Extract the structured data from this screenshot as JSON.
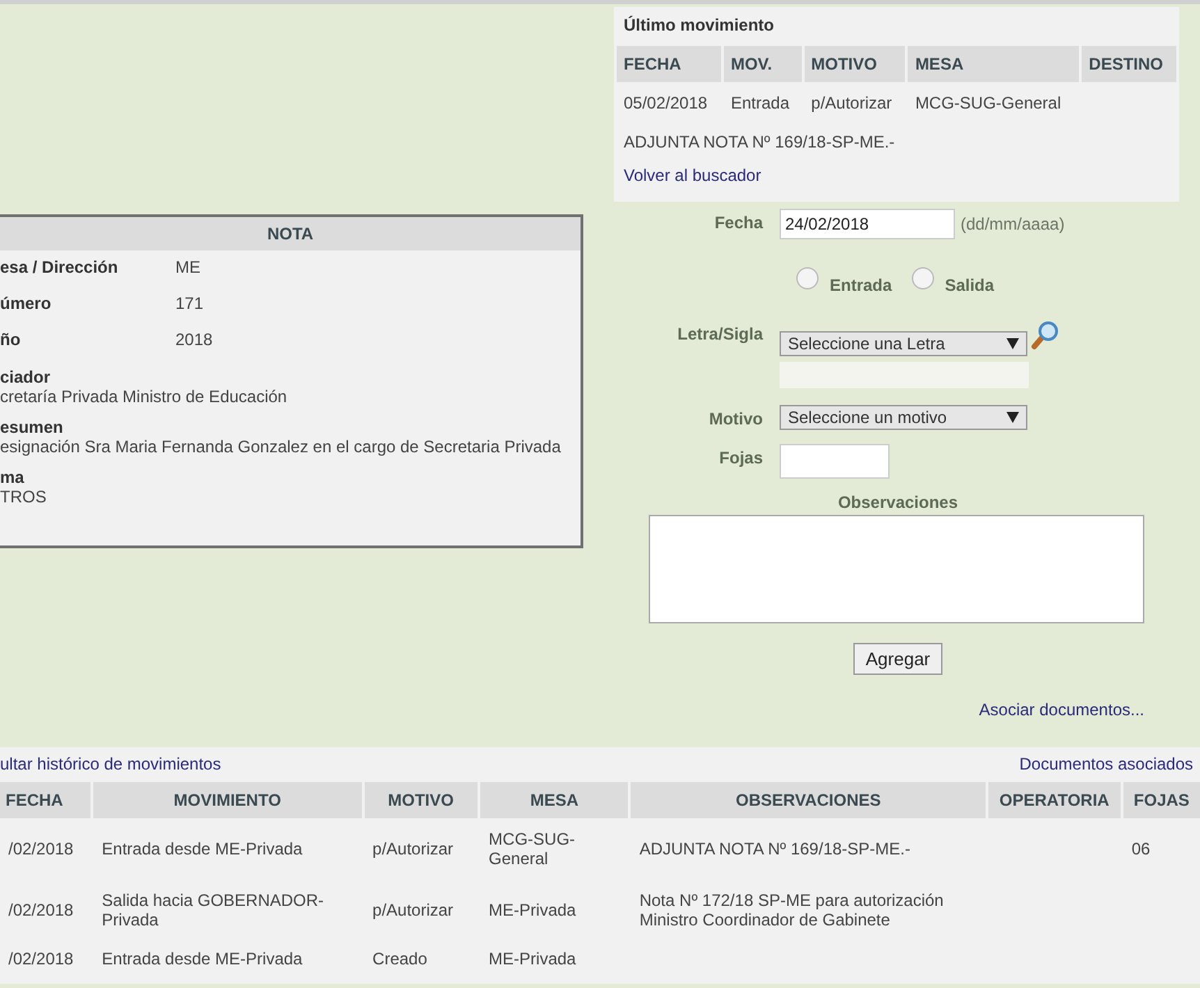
{
  "last_movement": {
    "title": "Último movimiento",
    "columns": [
      "FECHA",
      "MOV.",
      "MOTIVO",
      "MESA",
      "DESTINO"
    ],
    "row": [
      "05/02/2018",
      "Entrada",
      "p/Autorizar",
      "MCG-SUG-General"
    ],
    "observation": "ADJUNTA NOTA Nº 169/18-SP-ME.-",
    "link": "Volver al buscador"
  },
  "nota": {
    "title": "NOTA",
    "fields": [
      {
        "kind": "inline",
        "label": "esa / Dirección",
        "value": "ME"
      },
      {
        "kind": "inline",
        "label": "úmero",
        "value": "171"
      },
      {
        "kind": "inline",
        "label": "ño",
        "value": "2018"
      },
      {
        "kind": "stacked",
        "label": "ciador",
        "value": "cretaría Privada Ministro de Educación"
      },
      {
        "kind": "stacked",
        "label": "esumen",
        "value": "esignación Sra Maria Fernanda Gonzalez en el cargo de Secretaria Privada"
      },
      {
        "kind": "stacked",
        "label": "ma",
        "value": "TROS"
      }
    ]
  },
  "form": {
    "fecha_label": "Fecha",
    "fecha_value": "24/02/2018",
    "fecha_hint": "(dd/mm/aaaa)",
    "radios": [
      {
        "label": "Entrada",
        "selected": false
      },
      {
        "label": "Salida",
        "selected": false
      }
    ],
    "letra_label": "Letra/Sigla",
    "letra_select": "Seleccione una Letra",
    "motivo_label": "Motivo",
    "motivo_select": "Seleccione un motivo",
    "fojas_label": "Fojas",
    "observaciones_label": "Observaciones",
    "submit": "Agregar",
    "link": "Asociar documentos..."
  },
  "history": {
    "toggle_link": "ultar histórico de movimientos",
    "docs_link": "Documentos asociados",
    "columns": [
      "FECHA",
      "MOVIMIENTO",
      "MOTIVO",
      "MESA",
      "OBSERVACIONES",
      "OPERATORIA",
      "FOJAS"
    ],
    "rows": [
      [
        "/02/2018",
        "Entrada desde ME-Privada",
        "p/Autorizar",
        "MCG-SUG-General",
        "ADJUNTA NOTA Nº 169/18-SP-ME.-",
        "",
        "06"
      ],
      [
        "/02/2018",
        "Salida hacia GOBERNADOR-Privada",
        "p/Autorizar",
        "ME-Privada",
        "Nota Nº 172/18 SP-ME para autorización Ministro Coordinador de Gabinete",
        "",
        ""
      ],
      [
        "/02/2018",
        "Entrada desde ME-Privada",
        "Creado",
        "ME-Privada",
        "",
        "",
        ""
      ]
    ]
  }
}
